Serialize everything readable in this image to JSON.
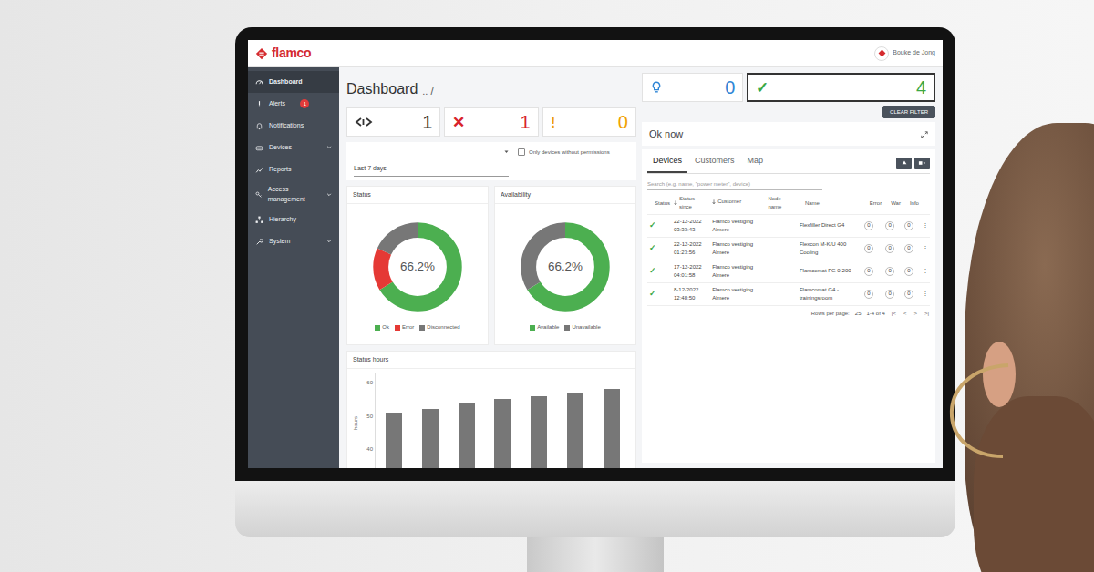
{
  "user": {
    "name": "Bouke de Jong"
  },
  "logo": {
    "text": "flamco"
  },
  "sidebar": {
    "items": [
      {
        "label": "Dashboard",
        "selected": true,
        "expandable": false
      },
      {
        "label": "Alerts",
        "selected": false,
        "expandable": false,
        "badge": "1"
      },
      {
        "label": "Notifications",
        "selected": false,
        "expandable": false
      },
      {
        "label": "Devices",
        "selected": false,
        "expandable": true
      },
      {
        "label": "Reports",
        "selected": false,
        "expandable": false
      },
      {
        "label": "Access management",
        "selected": false,
        "expandable": true
      },
      {
        "label": "Hierarchy",
        "selected": false,
        "expandable": false
      },
      {
        "label": "System",
        "selected": false,
        "expandable": true
      }
    ]
  },
  "header": {
    "title": "Dashboard",
    "breadcrumb": ".. /"
  },
  "counters": [
    {
      "kind": "connection",
      "value": "1",
      "color": "#333333",
      "selected": false
    },
    {
      "kind": "error",
      "glyph": "✕",
      "value": "1",
      "color": "#d8232a",
      "selected": false
    },
    {
      "kind": "warning",
      "glyph": "!",
      "value": "0",
      "color": "#f0a202",
      "selected": false
    },
    {
      "kind": "info",
      "value": "0",
      "color": "#2f86d6",
      "selected": false
    },
    {
      "kind": "ok",
      "glyph": "✓",
      "value": "4",
      "color": "#3aa845",
      "selected": true
    }
  ],
  "clear_filter": "CLEAR FILTER",
  "filters": {
    "permissions": {
      "label": "Only devices without permissions",
      "checked": false
    },
    "period": "Last 7 days"
  },
  "status_chart": {
    "title": "Status",
    "center": "66.2%",
    "segments": [
      {
        "label": "Ok",
        "value": 66.2,
        "color": "#4caf50"
      },
      {
        "label": "Error",
        "value": 15.6,
        "color": "#e53935"
      },
      {
        "label": "Disconnected",
        "value": 18.2,
        "color": "#777777"
      }
    ]
  },
  "availability_chart": {
    "title": "Availability",
    "center": "66.2%",
    "segments": [
      {
        "label": "Available",
        "value": 66.2,
        "color": "#4caf50"
      },
      {
        "label": "Unavailable",
        "value": 33.8,
        "color": "#777777"
      }
    ]
  },
  "status_hours_chart": {
    "title": "Status hours",
    "axis_label": "hours",
    "ticks": [
      {
        "label": "60",
        "value": 60
      },
      {
        "label": "50",
        "value": 50
      },
      {
        "label": "40",
        "value": 40
      }
    ],
    "values": [
      51,
      52,
      54,
      55,
      56,
      57,
      58
    ]
  },
  "status_panel": {
    "title": "Ok now"
  },
  "tabs": [
    {
      "label": "Devices",
      "selected": true
    },
    {
      "label": "Customers",
      "selected": false
    },
    {
      "label": "Map",
      "selected": false
    }
  ],
  "search": {
    "placeholder": "Search (e.g. name, \"power meter\", device)"
  },
  "table": {
    "columns": [
      {
        "label": "Status",
        "sorted": false
      },
      {
        "label": "Status since",
        "sorted": true
      },
      {
        "label": "Customer",
        "sorted": true
      },
      {
        "label": "Node name",
        "sorted": false
      },
      {
        "label": "Name",
        "sorted": false
      },
      {
        "label": "Error",
        "sorted": false
      },
      {
        "label": "War",
        "sorted": false
      },
      {
        "label": "Info",
        "sorted": false
      }
    ],
    "menu_glyph": "⋮",
    "rows": [
      {
        "ok": true,
        "glyph": "✓",
        "since_date": "22-12-2022",
        "since_time": "03:33:43",
        "customer": "Flamco vestiging Almere",
        "name": "Flexfiller Direct G4",
        "error": "0",
        "warning": "0",
        "info": "0"
      },
      {
        "ok": true,
        "glyph": "✓",
        "since_date": "22-12-2022",
        "since_time": "01:23:56",
        "customer": "Flamco vestiging Almere",
        "name": "Flexcon M-K/U 400 Cooling",
        "error": "0",
        "warning": "0",
        "info": "0"
      },
      {
        "ok": true,
        "glyph": "✓",
        "since_date": "17-12-2022",
        "since_time": "04:01:58",
        "customer": "Flamco vestiging Almere",
        "name": "Flamcomat FG 0-200",
        "error": "0",
        "warning": "0",
        "info": "0"
      },
      {
        "ok": true,
        "glyph": "✓",
        "since_date": "8-12-2022",
        "since_time": "12:48:50",
        "customer": "Flamco vestiging Almere",
        "name": "Flamcomat G4 - trainingsroom",
        "error": "0",
        "warning": "0",
        "info": "0"
      }
    ]
  },
  "pagination": {
    "label": "Rows per page:",
    "per_page": "25",
    "range": "1-4 of 4",
    "buttons": [
      "|<",
      "<",
      ">",
      ">|"
    ]
  }
}
